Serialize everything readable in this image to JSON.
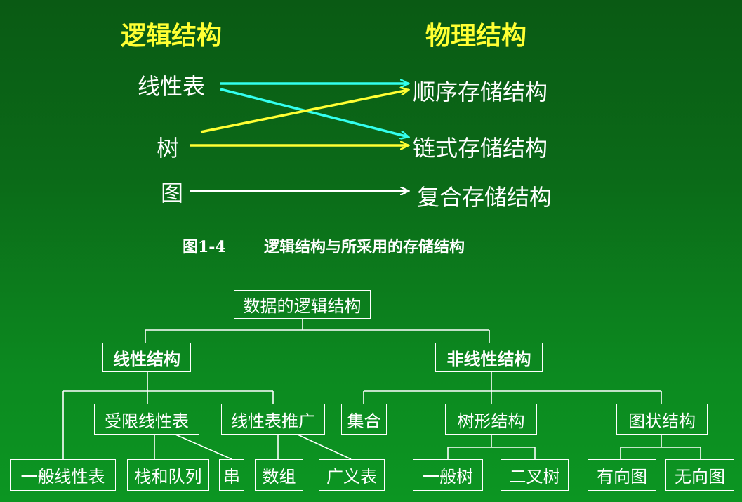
{
  "mapping": {
    "logical_heading": "逻辑结构",
    "physical_heading": "物理结构",
    "logical_items": [
      "线性表",
      "树",
      "图"
    ],
    "physical_items": [
      "顺序存储结构",
      "链式存储结构",
      "复合存储结构"
    ],
    "caption_number": "图1-4",
    "caption_text": "逻辑结构与所采用的存储结构",
    "colors": {
      "heading": "#ffff33",
      "cyan_arrow": "#33ffee",
      "yellow_arrow": "#ffff33",
      "white_arrow": "#ffffff"
    }
  },
  "tree": {
    "root": "数据的逻辑结构",
    "linear": "线性结构",
    "nonlinear": "非线性结构",
    "restricted_linear_list": "受限线性表",
    "generalized_linear_list": "线性表推广",
    "set": "集合",
    "tree_structure": "树形结构",
    "graph_structure": "图状结构",
    "general_linear_list": "一般线性表",
    "stack_queue": "栈和队列",
    "string": "串",
    "array": "数组",
    "generalized_list": "广义表",
    "general_tree": "一般树",
    "binary_tree": "二叉树",
    "directed_graph": "有向图",
    "undirected_graph": "无向图"
  }
}
